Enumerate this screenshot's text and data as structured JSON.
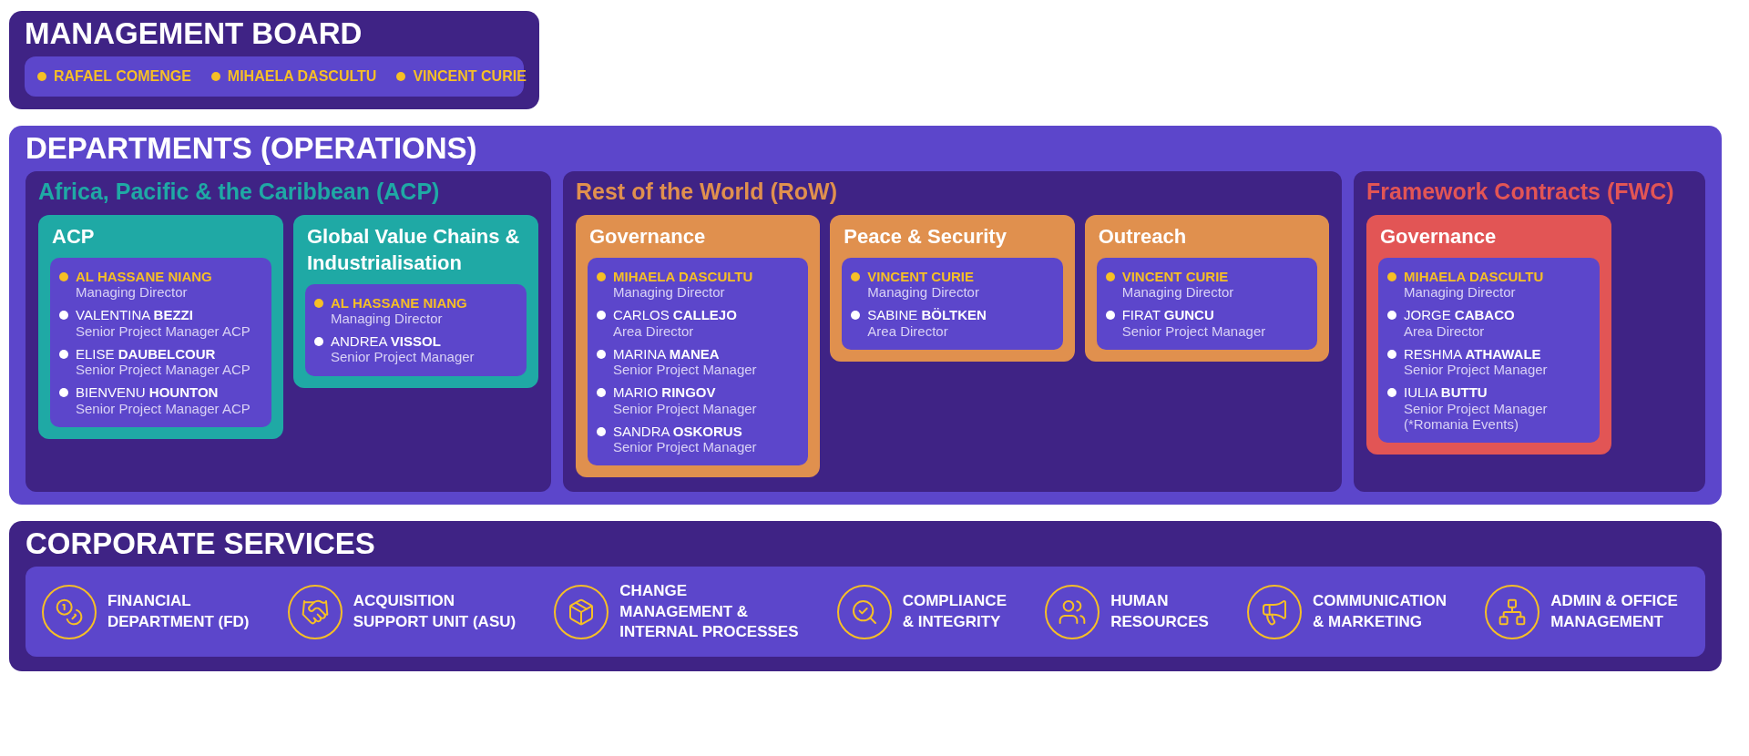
{
  "management_board": {
    "title": "MANAGEMENT BOARD",
    "members": [
      {
        "name": "RAFAEL COMENGE"
      },
      {
        "name": "MIHAELA DASCULTU"
      },
      {
        "name": "VINCENT CURIE"
      }
    ]
  },
  "departments": {
    "title": "DEPARTMENTS (OPERATIONS)",
    "regions": [
      {
        "title": "Africa, Pacific & the Caribbean (ACP)",
        "color": "#1fa9a5",
        "groups": [
          {
            "title": "ACP",
            "people": [
              {
                "name": "AL HASSANE NIANG",
                "role": "Managing Director",
                "lead": true
              },
              {
                "name": "VALENTINA **BEZZI**",
                "role": "Senior Project Manager ACP",
                "lead": false
              },
              {
                "name": "ELISE **DAUBELCOUR**",
                "role": "Senior Project Manager ACP",
                "lead": false
              },
              {
                "name": "BIENVENU **HOUNTON**",
                "role": "Senior Project Manager ACP",
                "lead": false
              }
            ]
          },
          {
            "title": "Global Value Chains & Industrialisation",
            "people": [
              {
                "name": "AL HASSANE NIANG",
                "role": "Managing Director",
                "lead": true
              },
              {
                "name": "ANDREA **VISSOL**",
                "role": "Senior Project Manager",
                "lead": false
              }
            ]
          }
        ]
      },
      {
        "title": "Rest of the World (RoW)",
        "color": "#e0904e",
        "groups": [
          {
            "title": "Governance",
            "people": [
              {
                "name": "MIHAELA DASCULTU",
                "role": "Managing Director",
                "lead": true
              },
              {
                "name": "CARLOS **CALLEJO**",
                "role": "Area Director",
                "lead": false
              },
              {
                "name": "MARINA **MANEA**",
                "role": "Senior Project Manager",
                "lead": false
              },
              {
                "name": "MARIO **RINGOV**",
                "role": "Senior Project Manager",
                "lead": false
              },
              {
                "name": "SANDRA **OSKORUS**",
                "role": "Senior Project Manager",
                "lead": false
              }
            ]
          },
          {
            "title": "Peace & Security",
            "people": [
              {
                "name": "VINCENT CURIE",
                "role": "Managing Director",
                "lead": true
              },
              {
                "name": "SABINE **BÖLTKEN**",
                "role": "Area Director",
                "lead": false
              }
            ]
          },
          {
            "title": "Outreach",
            "people": [
              {
                "name": "VINCENT CURIE",
                "role": "Managing Director",
                "lead": true
              },
              {
                "name": "FIRAT **GUNCU**",
                "role": "Senior Project Manager",
                "lead": false
              }
            ]
          }
        ]
      },
      {
        "title": "Framework Contracts (FWC)",
        "color": "#e25555",
        "groups": [
          {
            "title": "Governance",
            "people": [
              {
                "name": "MIHAELA DASCULTU",
                "role": "Managing Director",
                "lead": true
              },
              {
                "name": "JORGE **CABACO**",
                "role": "Area Director",
                "lead": false
              },
              {
                "name": "RESHMA **ATHAWALE**",
                "role": "Senior Project Manager",
                "lead": false
              },
              {
                "name": "IULIA **BUTTU**",
                "role": "Senior Project Manager (*Romania Events)",
                "lead": false
              }
            ]
          }
        ]
      }
    ]
  },
  "corporate_services": {
    "title": "CORPORATE SERVICES",
    "services": [
      {
        "label": "FINANCIAL\nDEPARTMENT (FD)"
      },
      {
        "label": "ACQUISITION\nSUPPORT UNIT (ASU)"
      },
      {
        "label": "CHANGE\nMANAGEMENT &\nINTERNAL PROCESSES"
      },
      {
        "label": "COMPLIANCE\n& INTEGRITY"
      },
      {
        "label": "HUMAN\nRESOURCES"
      },
      {
        "label": "COMMUNICATION\n& MARKETING"
      },
      {
        "label": "ADMIN & OFFICE\nMANAGEMENT"
      }
    ]
  }
}
